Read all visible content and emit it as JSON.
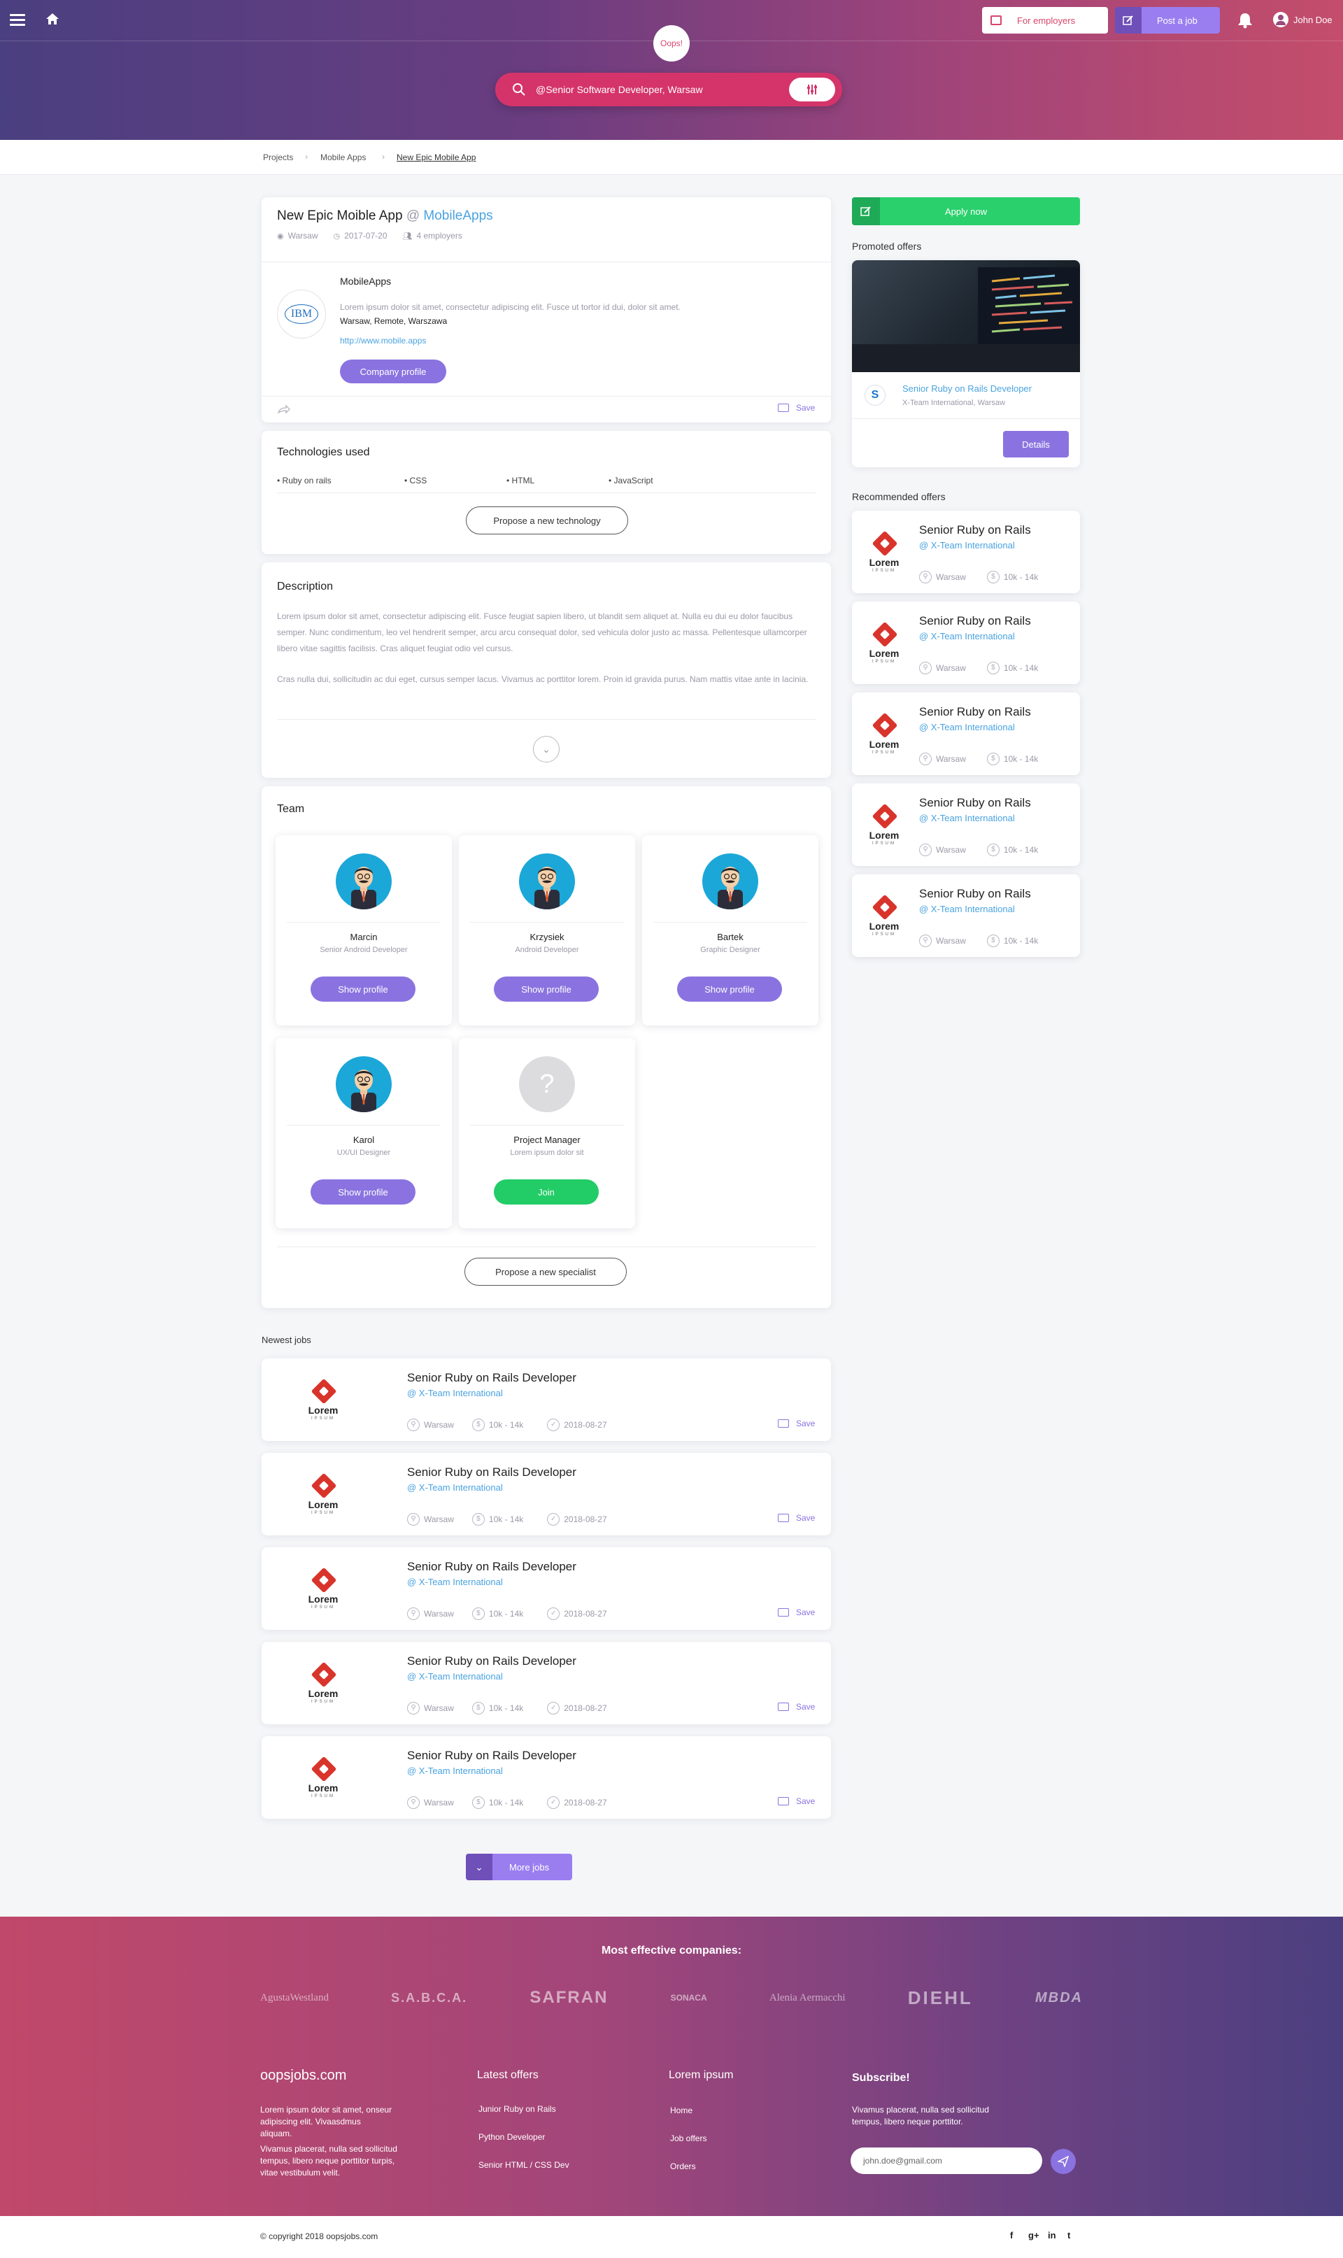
{
  "header": {
    "brand": "Oops!",
    "search_value": "@Senior Software Developer, Warsaw",
    "for_employers": "For employers",
    "post_job": "Post a job",
    "user_name": "John Doe"
  },
  "breadcrumb": [
    "Projects",
    "Mobile Apps",
    "New Epic Mobile App"
  ],
  "project": {
    "title": "New Epic Moible App",
    "at": "@",
    "company_link": "MobileApps",
    "location": "Warsaw",
    "date": "2017-07-20",
    "employers": "4 employers",
    "company_name": "MobileApps",
    "company_logo_text": "IBM",
    "company_desc": "Lorem ipsum dolor sit amet, consectetur adipiscing elit. Fusce ut tortor id dui,  dolor sit amet.",
    "company_locations": "Warsaw, Remote, Warszawa",
    "company_url": "http://www.mobile.apps",
    "company_profile": "Company profile",
    "save": "Save"
  },
  "technologies": {
    "title": "Technologies used",
    "items": [
      "Ruby on rails",
      "CSS",
      "HTML",
      "JavaScript"
    ],
    "propose": "Propose a new technology"
  },
  "description": {
    "title": "Description",
    "p1": "Lorem ipsum dolor sit amet, consectetur adipiscing elit. Fusce feugiat sapien libero, ut blandit sem aliquet at. Nulla eu dui eu dolor faucibus semper. Nunc condimentum, leo vel hendrerit semper, arcu arcu consequat dolor, sed vehicula dolor justo ac massa. Pellentesque ullamcorper libero vitae sagittis facilisis. Cras aliquet feugiat odio vel cursus.",
    "p2": "Cras nulla dui, sollicitudin ac dui eget, cursus semper lacus. Vivamus ac porttitor lorem. Proin id gravida purus. Nam mattis vitae ante in lacinia."
  },
  "team": {
    "title": "Team",
    "members": [
      {
        "name": "Marcin",
        "role": "Senior Android Developer",
        "action": "Show profile"
      },
      {
        "name": "Krzysiek",
        "role": "Android Developer",
        "action": "Show profile"
      },
      {
        "name": "Bartek",
        "role": "Graphic Designer",
        "action": "Show profile"
      },
      {
        "name": "Karol",
        "role": "UX/UI Designer",
        "action": "Show profile"
      },
      {
        "name": "Project Manager",
        "role": "Lorem ipsum dolor sit",
        "action": "Join"
      }
    ],
    "propose": "Propose a new specialist"
  },
  "newest_jobs": {
    "title": "Newest jobs",
    "logo_text": "Lorem",
    "logo_sub": "IPSUM",
    "items": [
      {
        "title": "Senior Ruby on Rails Developer",
        "company": "@ X-Team International",
        "location": "Warsaw",
        "salary": "10k - 14k",
        "date": "2018-08-27",
        "save": "Save"
      },
      {
        "title": "Senior Ruby on Rails Developer",
        "company": "@ X-Team International",
        "location": "Warsaw",
        "salary": "10k - 14k",
        "date": "2018-08-27",
        "save": "Save"
      },
      {
        "title": "Senior Ruby on Rails Developer",
        "company": "@ X-Team International",
        "location": "Warsaw",
        "salary": "10k - 14k",
        "date": "2018-08-27",
        "save": "Save"
      },
      {
        "title": "Senior Ruby on Rails Developer",
        "company": "@ X-Team International",
        "location": "Warsaw",
        "salary": "10k - 14k",
        "date": "2018-08-27",
        "save": "Save"
      },
      {
        "title": "Senior Ruby on Rails Developer",
        "company": "@ X-Team International",
        "location": "Warsaw",
        "salary": "10k - 14k",
        "date": "2018-08-27",
        "save": "Save"
      }
    ],
    "more": "More jobs"
  },
  "sidebar": {
    "apply": "Apply now",
    "promoted_title": "Promoted offers",
    "promoted": {
      "title": "Senior Ruby on Rails Developer",
      "subtitle": "X-Team International, Warsaw",
      "details": "Details"
    },
    "recommended_title": "Recommended offers",
    "recommended": [
      {
        "title": "Senior Ruby on Rails",
        "company": "@ X-Team International",
        "location": "Warsaw",
        "salary": "10k - 14k"
      },
      {
        "title": "Senior Ruby on Rails",
        "company": "@ X-Team International",
        "location": "Warsaw",
        "salary": "10k - 14k"
      },
      {
        "title": "Senior Ruby on Rails",
        "company": "@ X-Team International",
        "location": "Warsaw",
        "salary": "10k - 14k"
      },
      {
        "title": "Senior Ruby on Rails",
        "company": "@ X-Team International",
        "location": "Warsaw",
        "salary": "10k - 14k"
      },
      {
        "title": "Senior Ruby on Rails",
        "company": "@ X-Team International",
        "location": "Warsaw",
        "salary": "10k - 14k"
      }
    ]
  },
  "footer": {
    "companies_title": "Most effective companies:",
    "companies": [
      "AgustaWestland",
      "S.A.B.C.A.",
      "SAFRAN",
      "SONACA",
      "Alenia Aermacchi",
      "DIEHL",
      "MBDA"
    ],
    "brand": "oopsjobs.com",
    "about1": "Lorem ipsum dolor sit amet, onseur adipiscing elit. Vivaasdmus aliquam.",
    "about2": "Vivamus placerat, nulla sed sollicitud tempus, libero neque porttitor turpis, vitae vestibulum velit.",
    "latest_title": "Latest offers",
    "latest": [
      "Junior Ruby on Rails",
      "Python Developer",
      "Senior HTML / CSS Dev"
    ],
    "lorem_title": "Lorem ipsum",
    "lorem_links": [
      "Home",
      "Job offers",
      "Orders"
    ],
    "subscribe_title": "Subscribe!",
    "subscribe_text": "Vivamus placerat, nulla sed sollicitud tempus, libero neque porttitor.",
    "email_value": "john.doe@gmail.com",
    "copyright": "© copyright 2018 oopsjobs.com",
    "social": [
      "f",
      "g+",
      "in",
      "t"
    ]
  }
}
